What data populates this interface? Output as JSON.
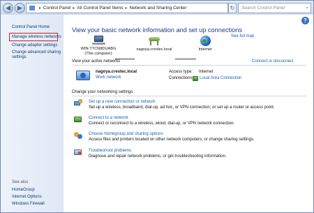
{
  "address": {
    "crumbs": [
      "Control Panel",
      "All Control Panel Items",
      "Network and Sharing Center"
    ],
    "search_placeholder": "Search Control Panel"
  },
  "sidebar": {
    "home": "Control Panel Home",
    "items": [
      {
        "label": "Manage wireless networks",
        "highlighted": true
      },
      {
        "label": "Change adapter settings"
      },
      {
        "label": "Change advanced sharing settings"
      }
    ],
    "see_also_title": "See also",
    "see_also": [
      "HomeGroup",
      "Internet Options",
      "Windows Firewall"
    ]
  },
  "main": {
    "heading": "View your basic network information and set up connections",
    "see_full_map": "See full map",
    "map": {
      "computer_name": "WIN-TTCN8DUABG",
      "computer_sub": "(This computer)",
      "network_name": "nagoya.crestec.local",
      "internet": "Internet"
    },
    "active_title": "View your active networks",
    "connect_disconnect": "Connect or disconnect",
    "active": {
      "name": "nagoya.crestec.local",
      "type": "Work network",
      "access_label": "Access type:",
      "access_value": "Internet",
      "connections_label": "Connections:",
      "connections_value": "Local Area Connection"
    },
    "change_title": "Change your networking settings",
    "tasks": [
      {
        "title": "Set up a new connection or network",
        "desc": "Set up a wireless, broadband, dial-up, ad hoc, or VPN connection; or set up a router or access point."
      },
      {
        "title": "Connect to a network",
        "desc": "Connect or reconnect to a wireless, wired, dial-up, or VPN network connection."
      },
      {
        "title": "Choose homegroup and sharing options",
        "desc": "Access files and printers located on other network computers, or change sharing settings."
      },
      {
        "title": "Troubleshoot problems",
        "desc": "Diagnose and repair network problems, or get troubleshooting information."
      }
    ]
  }
}
